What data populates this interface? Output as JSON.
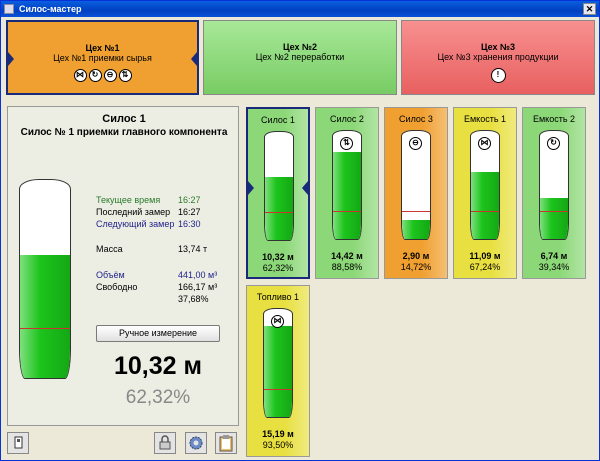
{
  "window": {
    "title": "Силос-мастер",
    "close": "✕"
  },
  "shops": [
    {
      "name": "Цех №1",
      "desc": "Цех №1 приемки сырья",
      "color": "#f0a030"
    },
    {
      "name": "Цех №2",
      "desc": "Цех №2 переработки",
      "color": "#8cd878"
    },
    {
      "name": "Цех №3",
      "desc": "Цех №3 хранения продукции",
      "color": "#f07070"
    }
  ],
  "detail": {
    "title": "Силос 1",
    "subtitle": "Силос № 1 приемки главного компонента",
    "rows": [
      {
        "label": "Текущее время",
        "value": "16:27"
      },
      {
        "label": "Последний замер",
        "value": "16:27"
      },
      {
        "label": "Следующий замер",
        "value": "16:30"
      },
      {
        "label": "Масса",
        "value": "13,74 т"
      },
      {
        "label": "Объём",
        "value": "441,00 м³"
      },
      {
        "label": "Свободно",
        "value": "166,17 м³"
      }
    ],
    "free_percent": "37,68%",
    "manual_button": "Ручное измерение",
    "level": "10,32 м",
    "fill_percent": "62,32%",
    "fill_fraction": 0.6232
  },
  "silos": [
    {
      "name": "Силос 1",
      "level": "10,32 м",
      "percent": "62,32%",
      "fill": 0.6232,
      "icon": "",
      "color": "#8cd878",
      "selected": true
    },
    {
      "name": "Силос 2",
      "level": "14,42 м",
      "percent": "88,58%",
      "fill": 0.8858,
      "icon": "⇅",
      "color": "#8cd878",
      "selected": false
    },
    {
      "name": "Силос 3",
      "level": "2,90 м",
      "percent": "14,72%",
      "fill": 0.1472,
      "icon": "⊖",
      "color": "#f0a030",
      "selected": false
    },
    {
      "name": "Емкость 1",
      "level": "11,09 м",
      "percent": "67,24%",
      "fill": 0.6724,
      "icon": "⋈",
      "color": "#e8e040",
      "selected": false
    },
    {
      "name": "Емкость 2",
      "level": "6,74 м",
      "percent": "39,34%",
      "fill": 0.3934,
      "icon": "↻",
      "color": "#8cd878",
      "selected": false
    },
    {
      "name": "Топливо 1",
      "level": "15,19 м",
      "percent": "93,50%",
      "fill": 0.935,
      "icon": "⋈",
      "color": "#e8e040",
      "selected": false
    }
  ],
  "shop1_icons": [
    "⋈",
    "↻",
    "⊖",
    "⇅"
  ],
  "shop3_icon": "!"
}
